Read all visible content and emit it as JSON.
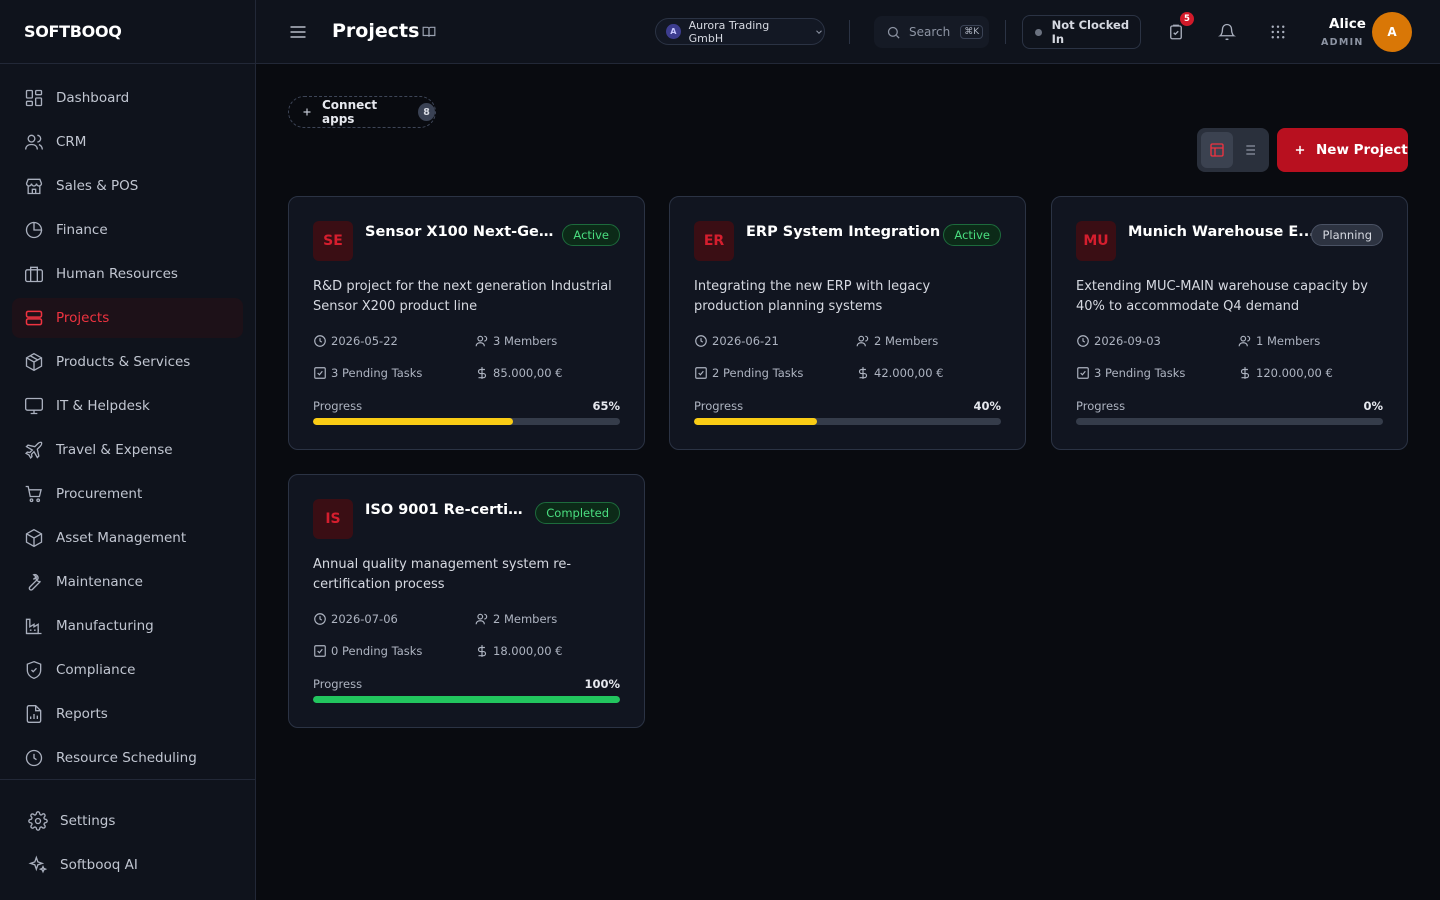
{
  "app": {
    "brand": "SOFTBOOQ"
  },
  "sidebar": {
    "items": [
      {
        "label": "Dashboard",
        "icon": "grid-icon",
        "active": false
      },
      {
        "label": "CRM",
        "icon": "users-icon",
        "active": false
      },
      {
        "label": "Sales & POS",
        "icon": "store-icon",
        "active": false
      },
      {
        "label": "Finance",
        "icon": "pie-chart-icon",
        "active": false
      },
      {
        "label": "Human Resources",
        "icon": "briefcase-icon",
        "active": false
      },
      {
        "label": "Projects",
        "icon": "layers-icon",
        "active": true
      },
      {
        "label": "Products & Services",
        "icon": "package-icon",
        "active": false
      },
      {
        "label": "IT & Helpdesk",
        "icon": "monitor-icon",
        "active": false
      },
      {
        "label": "Travel & Expense",
        "icon": "plane-icon",
        "active": false
      },
      {
        "label": "Procurement",
        "icon": "cart-icon",
        "active": false
      },
      {
        "label": "Asset Management",
        "icon": "cube-icon",
        "active": false
      },
      {
        "label": "Maintenance",
        "icon": "wrench-icon",
        "active": false
      },
      {
        "label": "Manufacturing",
        "icon": "factory-icon",
        "active": false
      },
      {
        "label": "Compliance",
        "icon": "shield-icon",
        "active": false
      },
      {
        "label": "Reports",
        "icon": "report-icon",
        "active": false
      },
      {
        "label": "Resource Scheduling",
        "icon": "clock-icon",
        "active": false
      }
    ],
    "bottom": [
      {
        "label": "Settings",
        "icon": "gear-icon"
      },
      {
        "label": "Softbooq AI",
        "icon": "sparkles-icon"
      }
    ]
  },
  "header": {
    "title": "Projects",
    "company": {
      "initial": "A",
      "name": "Aurora Trading GmbH"
    },
    "search": {
      "label": "Search",
      "shortcut": "⌘K"
    },
    "clock_status": "Not Clocked In",
    "tasks_badge": "5",
    "user": {
      "name": "Alice",
      "role": "ADMIN",
      "initial": "A"
    }
  },
  "toolbar": {
    "connect_label": "Connect apps",
    "connect_count": "8",
    "new_project_label": "New Project"
  },
  "colors": {
    "accent": "#ef3340",
    "progress_in_progress": "#facc15",
    "progress_complete": "#22c55e"
  },
  "projects": [
    {
      "abbr": "SE",
      "title": "Sensor X100 Next-Gen ...",
      "status": "Active",
      "description": "R&D project for the next generation Industrial Sensor X200 product line",
      "date": "2026-05-22",
      "members": "3 Members",
      "tasks": "3 Pending Tasks",
      "budget": "85.000,00 €",
      "progress_label": "Progress",
      "progress_text": "65%",
      "progress": 65
    },
    {
      "abbr": "ER",
      "title": "ERP System Integration",
      "status": "Active",
      "description": "Integrating the new ERP with legacy production planning systems",
      "date": "2026-06-21",
      "members": "2 Members",
      "tasks": "2 Pending Tasks",
      "budget": "42.000,00 €",
      "progress_label": "Progress",
      "progress_text": "40%",
      "progress": 40
    },
    {
      "abbr": "MU",
      "title": "Munich Warehouse E...",
      "status": "Planning",
      "description": "Extending MUC-MAIN warehouse capacity by 40% to accommodate Q4 demand",
      "date": "2026-09-03",
      "members": "1 Members",
      "tasks": "3 Pending Tasks",
      "budget": "120.000,00 €",
      "progress_label": "Progress",
      "progress_text": "0%",
      "progress": 0
    },
    {
      "abbr": "IS",
      "title": "ISO 9001 Re-certifi...",
      "status": "Completed",
      "description": "Annual quality management system re-certification process",
      "date": "2026-07-06",
      "members": "2 Members",
      "tasks": "0 Pending Tasks",
      "budget": "18.000,00 €",
      "progress_label": "Progress",
      "progress_text": "100%",
      "progress": 100
    }
  ]
}
